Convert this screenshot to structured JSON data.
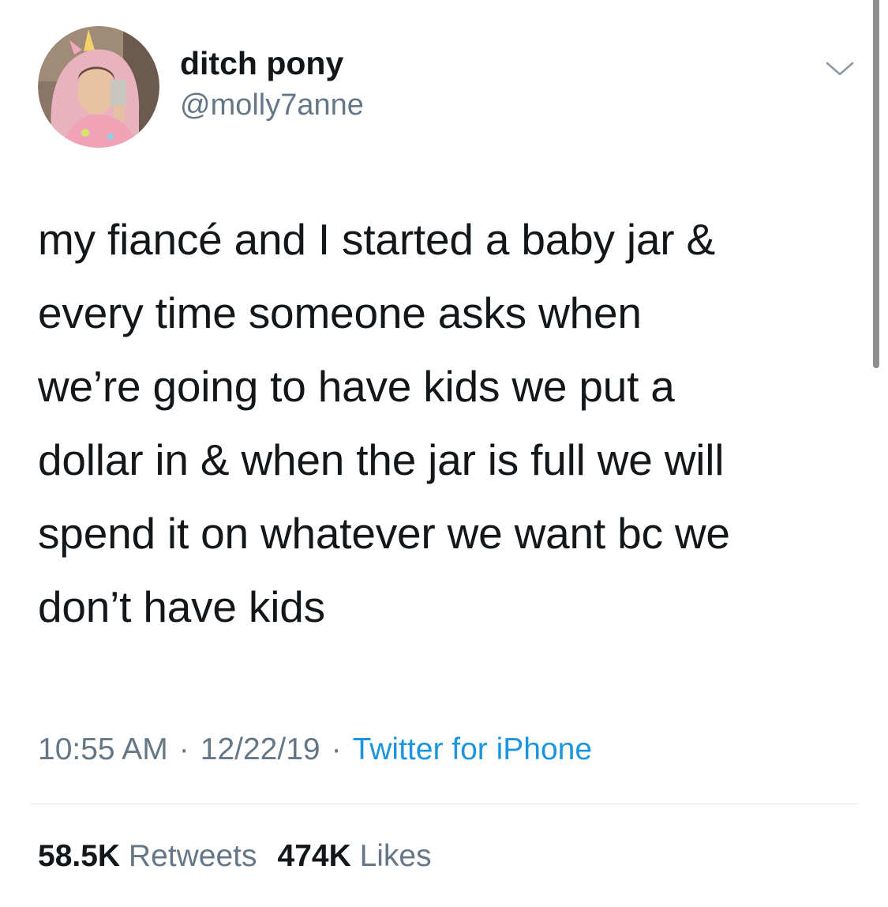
{
  "author": {
    "display_name": "ditch pony",
    "handle": "@molly7anne",
    "avatar_icon": "avatar-photo"
  },
  "menu_icon": "chevron-down-icon",
  "tweet": {
    "lines": [
      "my fiancé and I started a baby jar &",
      "every time someone asks when",
      "we’re going to have kids we put a",
      "dollar in & when the jar is full we will",
      "spend it on whatever we want bc we",
      "don’t have kids"
    ]
  },
  "meta": {
    "time": "10:55 AM",
    "separator": "·",
    "date": "12/22/19",
    "source": "Twitter for iPhone"
  },
  "stats": {
    "retweets_count": "58.5K",
    "retweets_label": "Retweets",
    "likes_count": "474K",
    "likes_label": "Likes"
  },
  "colors": {
    "text": "#14171a",
    "secondary": "#657786",
    "link": "#1b95e0",
    "divider": "#e1e8ed"
  }
}
